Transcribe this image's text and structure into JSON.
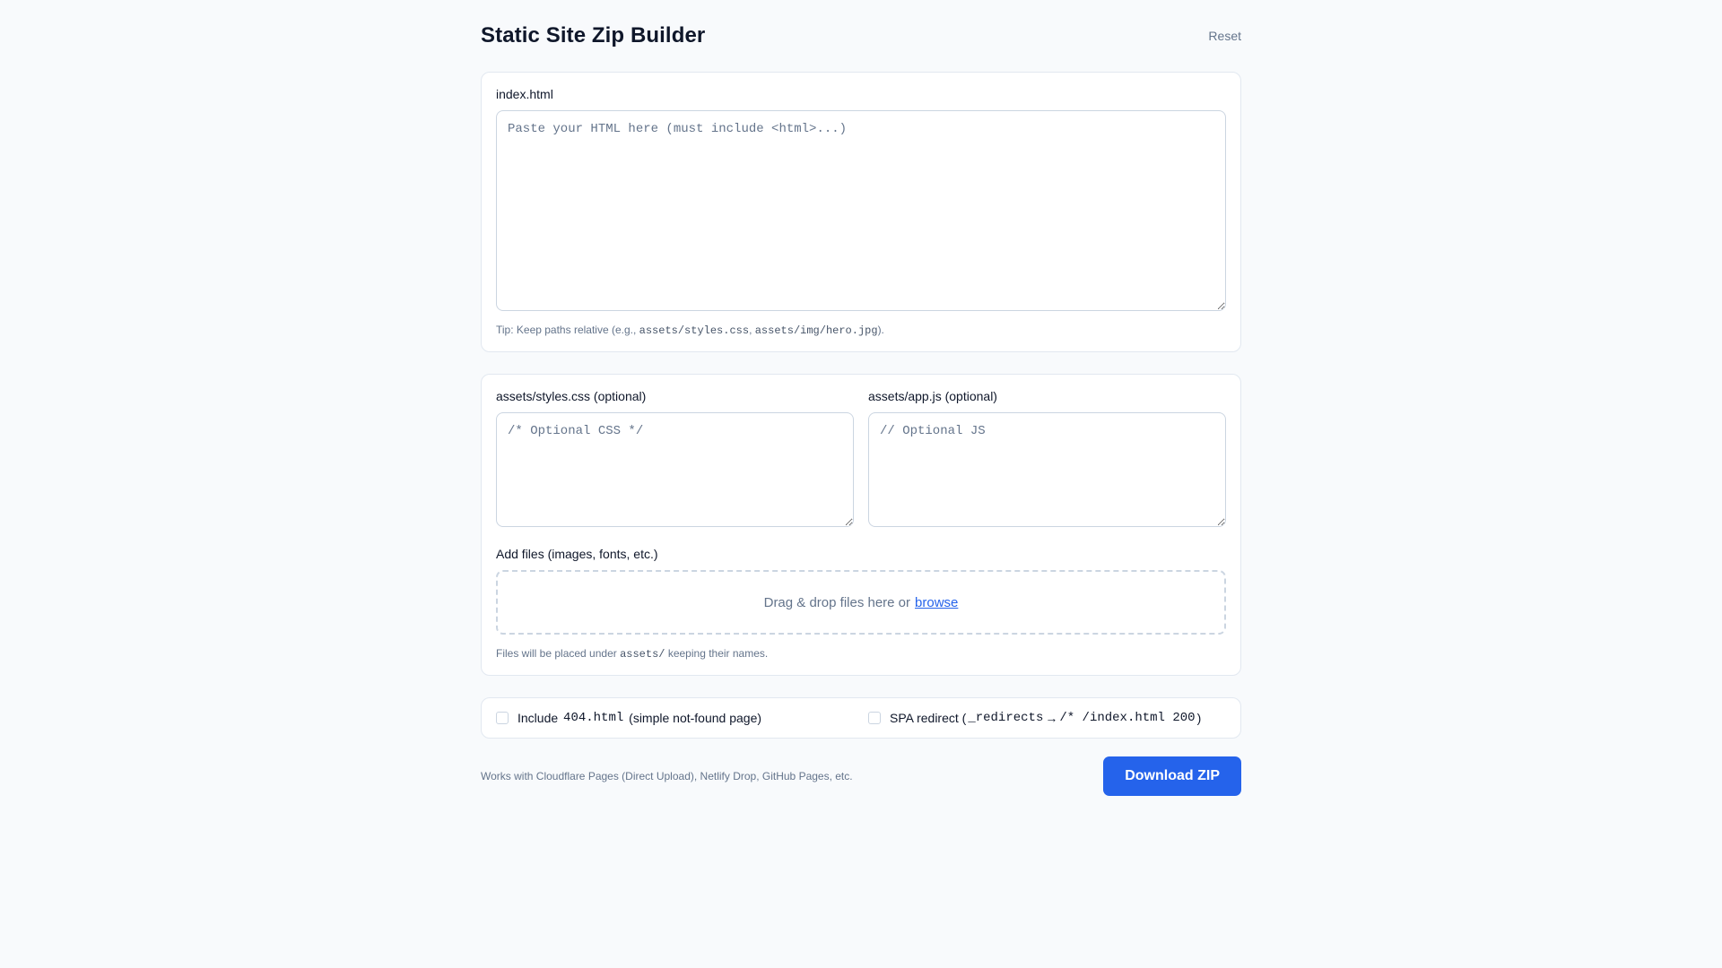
{
  "header": {
    "title": "Static Site Zip Builder",
    "reset_label": "Reset"
  },
  "html_section": {
    "label": "index.html",
    "placeholder": "Paste your HTML here (must include <html>...)",
    "tip_prefix": "Tip: Keep paths relative (e.g., ",
    "tip_code_1": "assets/styles.css",
    "tip_sep": ", ",
    "tip_code_2": "assets/img/hero.jpg",
    "tip_suffix": ")."
  },
  "assets_section": {
    "css_label": "assets/styles.css (optional)",
    "css_placeholder": "/* Optional CSS */",
    "js_label": "assets/app.js (optional)",
    "js_placeholder": "// Optional JS",
    "files_label": "Add files (images, fonts, etc.)",
    "dropzone_text": "Drag & drop files here or",
    "browse_label": "browse",
    "files_note_prefix": "Files will be placed under ",
    "files_note_code": "assets/",
    "files_note_suffix": " keeping their names."
  },
  "options": {
    "include_404": {
      "prefix": "Include",
      "code": "404.html",
      "suffix": "(simple not-found page)",
      "checked": false
    },
    "spa_redirect": {
      "prefix": "SPA redirect (",
      "code_1": "_redirects",
      "arrow": "→",
      "code_2": "/* /index.html 200",
      "suffix": ")",
      "checked": false
    }
  },
  "footer": {
    "note": "Works with Cloudflare Pages (Direct Upload), Netlify Drop, GitHub Pages, etc.",
    "download_label": "Download ZIP"
  },
  "colors": {
    "accent": "#2563eb",
    "background": "#f8fafc",
    "border": "#e2e8f0"
  }
}
